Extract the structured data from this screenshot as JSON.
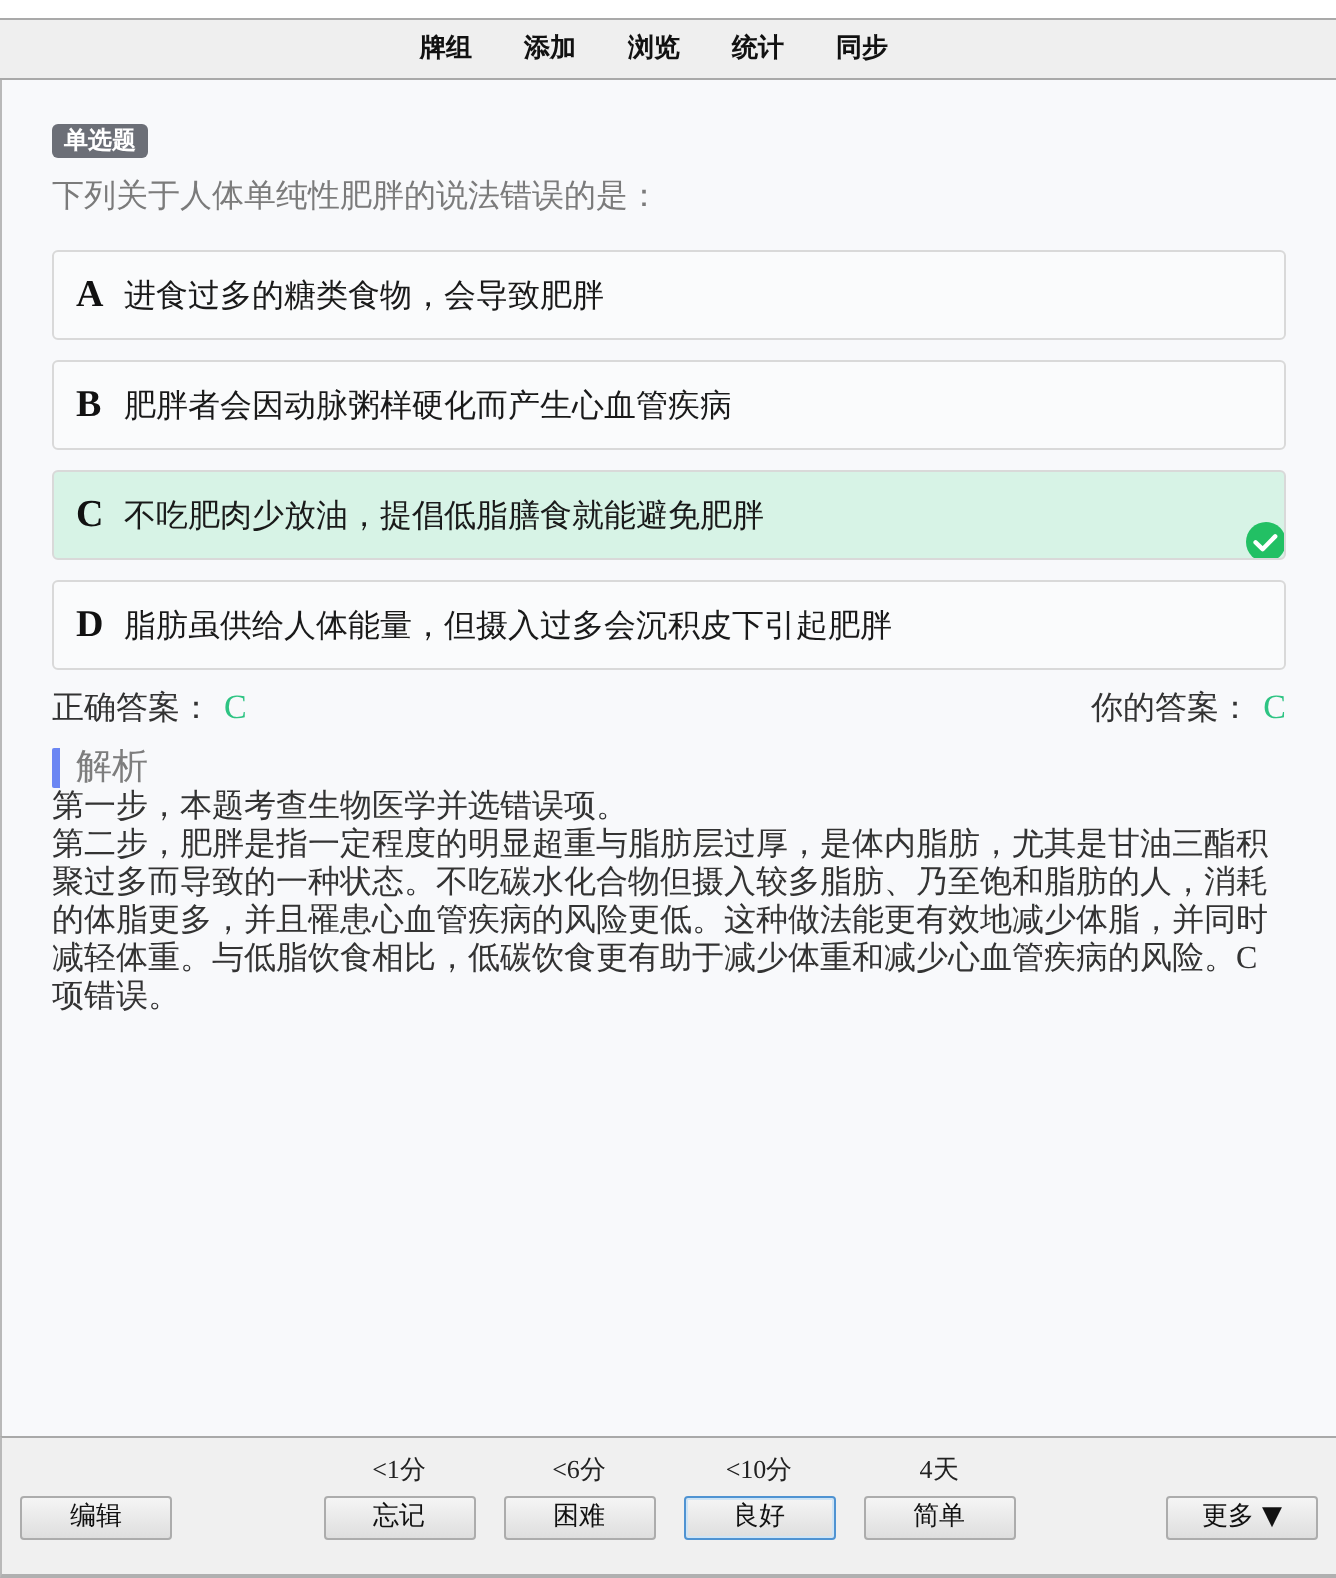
{
  "toolbar": {
    "tabs": [
      "牌组",
      "添加",
      "浏览",
      "统计",
      "同步"
    ]
  },
  "question": {
    "type_badge": "单选题",
    "text": "下列关于人体单纯性肥胖的说法错误的是："
  },
  "options": [
    {
      "letter": "A",
      "text": "进食过多的糖类食物，会导致肥胖",
      "correct": false
    },
    {
      "letter": "B",
      "text": "肥胖者会因动脉粥样硬化而产生心血管疾病",
      "correct": false
    },
    {
      "letter": "C",
      "text": "不吃肥肉少放油，提倡低脂膳食就能避免肥胖",
      "correct": true
    },
    {
      "letter": "D",
      "text": "脂肪虽供给人体能量，但摄入过多会沉积皮下引起肥胖",
      "correct": false
    }
  ],
  "answers": {
    "correct_label": "正确答案：",
    "correct_value": "C",
    "yours_label": "你的答案：",
    "yours_value": "C"
  },
  "explanation": {
    "heading": "解析",
    "paragraphs": [
      "第一步，本题考查生物医学并选错误项。",
      "第二步，肥胖是指一定程度的明显超重与脂肪层过厚，是体内脂肪，尤其是甘油三酯积聚过多而导致的一种状态。不吃碳水化合物但摄入较多脂肪、乃至饱和脂肪的人，消耗的体脂更多，并且罹患心血管疾病的风险更低。这种做法能更有效地减少体脂，并同时减轻体重。与低脂饮食相比，低碳饮食更有助于减少体重和减少心血管疾病的风险。C项错误。"
    ]
  },
  "bottom_bar": {
    "edit_button": "编辑",
    "ease_buttons": [
      {
        "interval": "<1分",
        "label": "忘记",
        "focused": false
      },
      {
        "interval": "<6分",
        "label": "困难",
        "focused": false
      },
      {
        "interval": "<10分",
        "label": "良好",
        "focused": true
      },
      {
        "interval": "4天",
        "label": "简单",
        "focused": false
      }
    ],
    "more_button": "更多 ▼"
  }
}
